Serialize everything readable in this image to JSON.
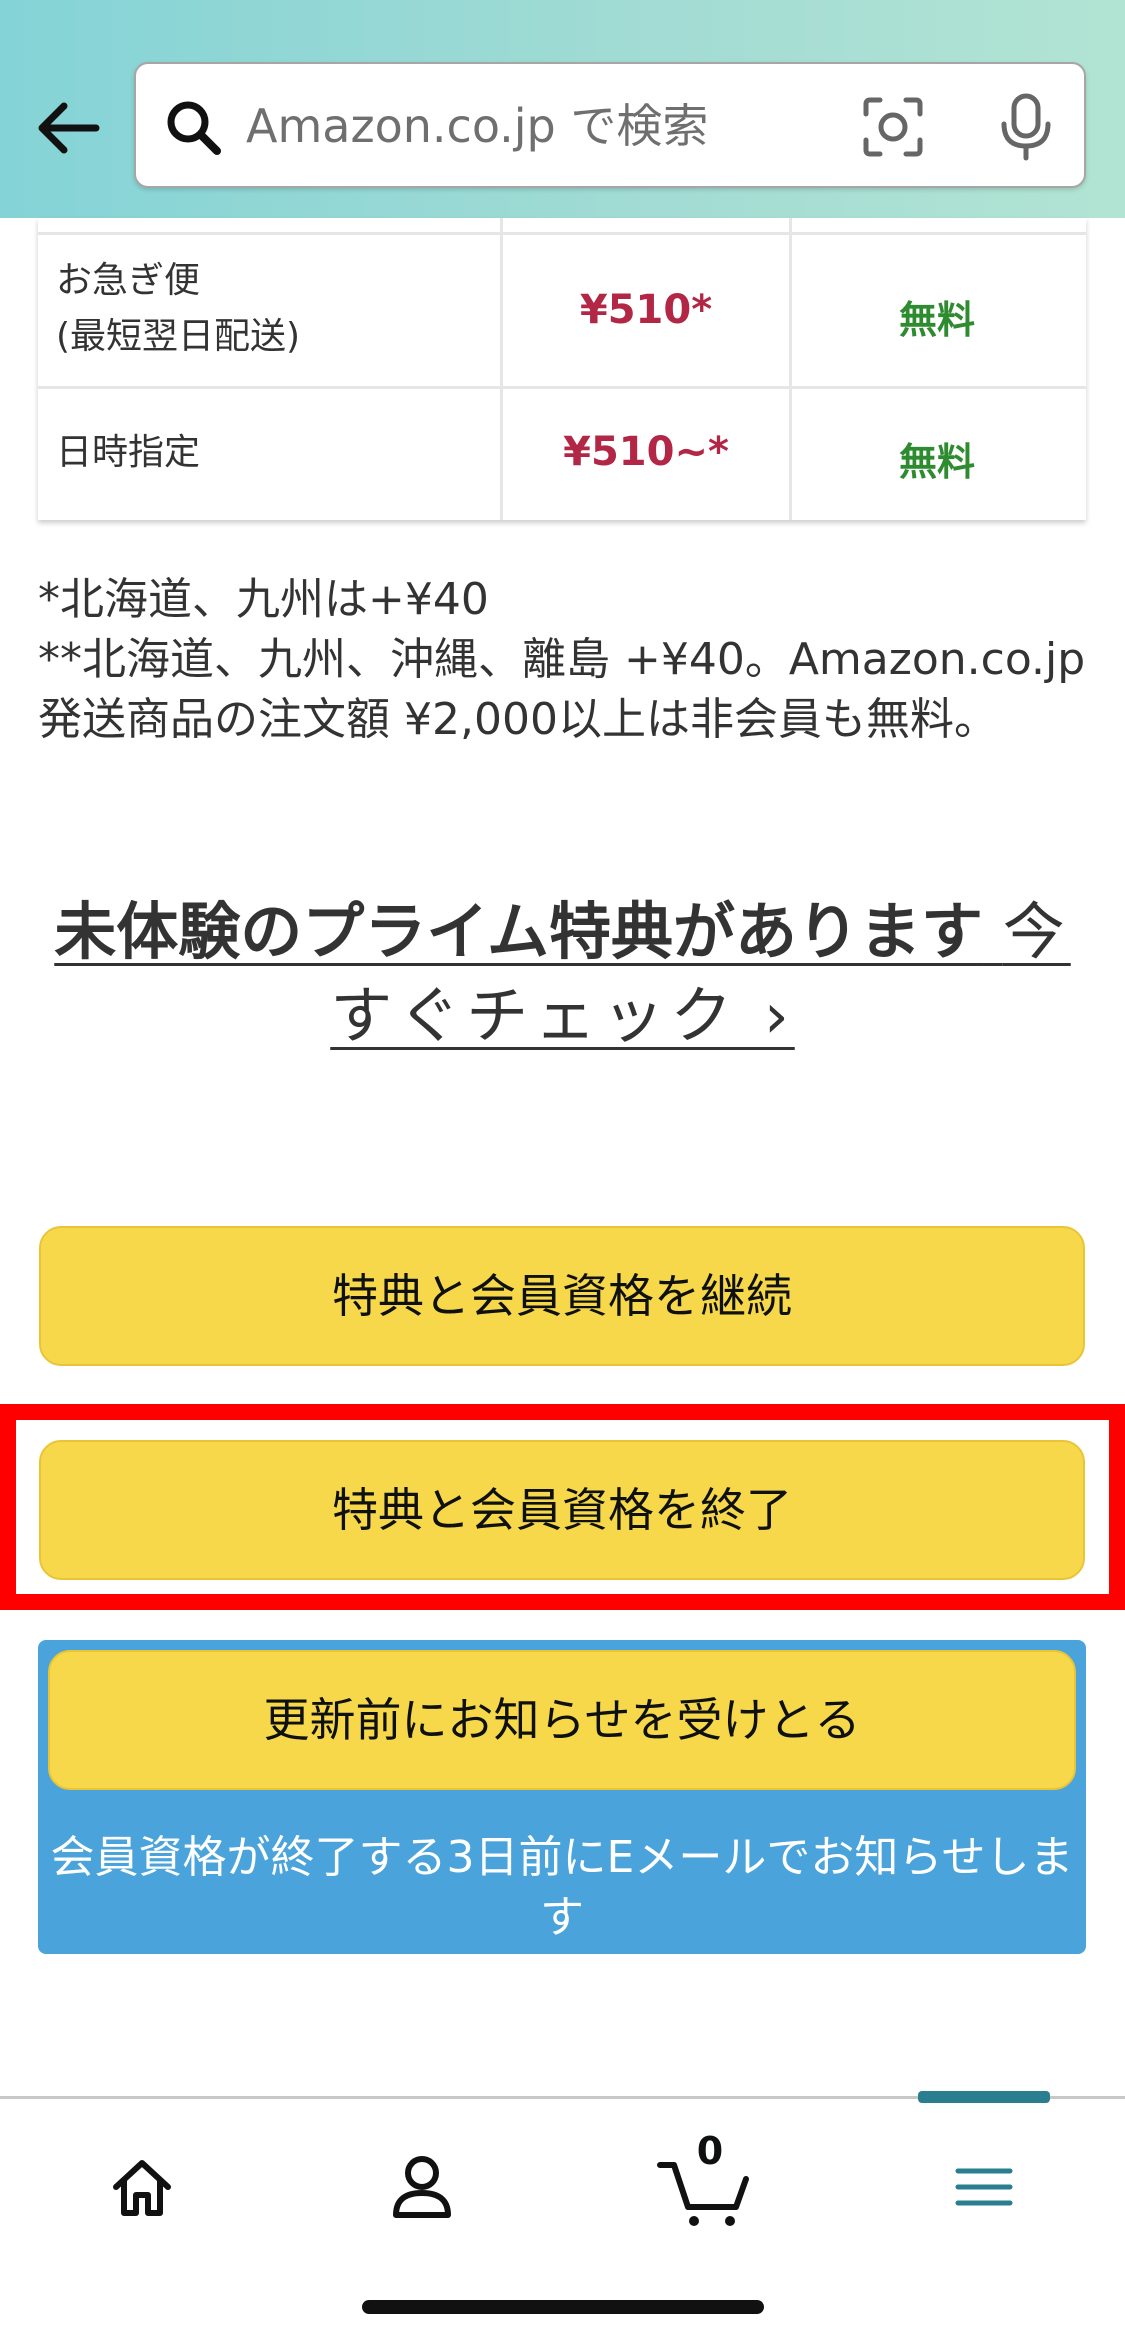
{
  "header": {
    "search_placeholder": "Amazon.co.jp で検索",
    "icons": [
      "back-arrow-icon",
      "search-icon",
      "camera-icon",
      "mic-icon"
    ]
  },
  "shipping_table": {
    "rows": [
      {
        "label_line1": "お急ぎ便",
        "label_line2": "(最短翌日配送)",
        "price": "¥510*",
        "member": "無料"
      },
      {
        "label_line1": "日時指定",
        "label_line2": "",
        "price": "¥510~*",
        "member": "無料"
      }
    ]
  },
  "notes": {
    "line1": "*北海道、九州は+¥40",
    "line2": "**北海道、九州、沖縄、離島 +¥40。Amazon.co.jp発送商品の注文額 ¥2,000以上は非会員も無料。"
  },
  "promo": {
    "bold_text": "未体験のプライム特典があります",
    "link_text": "今すぐチェック ›"
  },
  "buttons": {
    "continue": "特典と会員資格を継続",
    "end": "特典と会員資格を終了",
    "notify": "更新前にお知らせを受けとる"
  },
  "notify_info": "会員資格が終了する3日前にEメールでお知らせします",
  "bottom_nav": {
    "cart_count": "0",
    "items": [
      "home-icon",
      "account-icon",
      "cart-icon",
      "menu-icon"
    ],
    "active": "menu"
  },
  "colors": {
    "header_accent": "#84d3d6",
    "price_red": "#b12745",
    "free_green": "#2f8b2f",
    "button_yellow": "#f7d84a",
    "panel_blue": "#4aa4db",
    "highlight_red": "#ff0000",
    "nav_active": "#2a7e8f"
  }
}
